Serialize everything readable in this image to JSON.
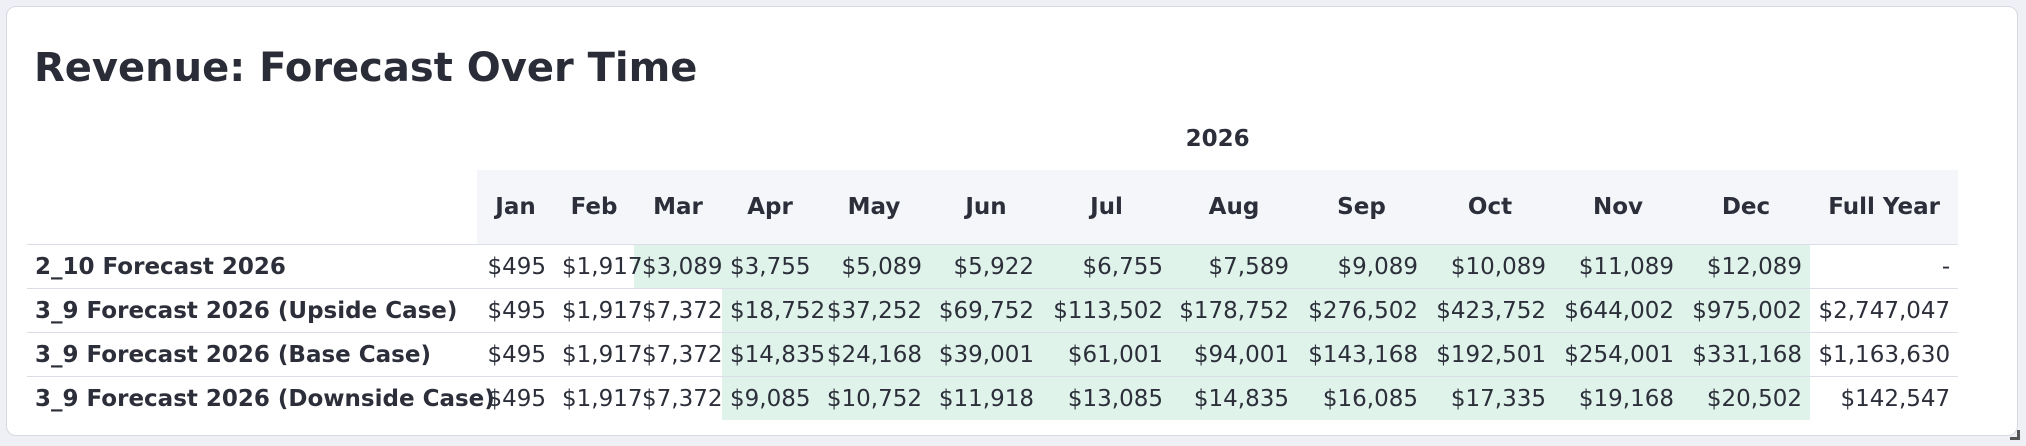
{
  "title": "Revenue: Forecast Over Time",
  "year": "2026",
  "columns": [
    "Jan",
    "Feb",
    "Mar",
    "Apr",
    "May",
    "Jun",
    "Jul",
    "Aug",
    "Sep",
    "Oct",
    "Nov",
    "Dec",
    "Full Year"
  ],
  "rows": [
    {
      "label": "2_10 Forecast 2026",
      "values": [
        "$495",
        "$1,917",
        "$3,089",
        "$3,755",
        "$5,089",
        "$5,922",
        "$6,755",
        "$7,589",
        "$9,089",
        "$10,089",
        "$11,089",
        "$12,089",
        "-"
      ]
    },
    {
      "label": "3_9 Forecast 2026 (Upside Case)",
      "values": [
        "$495",
        "$1,917",
        "$7,372",
        "$18,752",
        "$37,252",
        "$69,752",
        "$113,502",
        "$178,752",
        "$276,502",
        "$423,752",
        "$644,002",
        "$975,002",
        "$2,747,047"
      ]
    },
    {
      "label": "3_9 Forecast 2026 (Base Case)",
      "values": [
        "$495",
        "$1,917",
        "$7,372",
        "$14,835",
        "$24,168",
        "$39,001",
        "$61,001",
        "$94,001",
        "$143,168",
        "$192,501",
        "$254,001",
        "$331,168",
        "$1,163,630"
      ]
    },
    {
      "label": "3_9 Forecast 2026 (Downside Case)",
      "values": [
        "$495",
        "$1,917",
        "$7,372",
        "$9,085",
        "$10,752",
        "$11,918",
        "$13,085",
        "$14,835",
        "$16,085",
        "$17,335",
        "$19,168",
        "$20,502",
        "$142,547"
      ]
    }
  ],
  "highlight_color": "#dff3ea"
}
